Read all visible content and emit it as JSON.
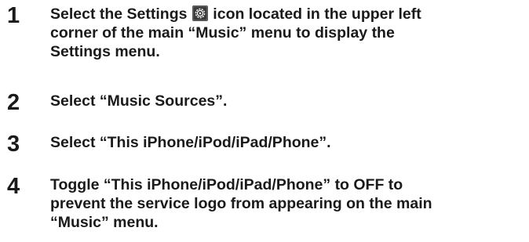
{
  "steps": [
    {
      "number": "1",
      "line1_before_icon": "Select the Settings ",
      "line1_icon": "settings-gear-icon",
      "line1_after_icon": " icon located in the upper left",
      "line2": "corner of the main “Music” menu to display the",
      "line3": "Settings menu."
    },
    {
      "number": "2",
      "line1": "Select “Music Sources”."
    },
    {
      "number": "3",
      "line1": "Select “This iPhone/iPod/iPad/Phone”."
    },
    {
      "number": "4",
      "line1": "Toggle “This iPhone/iPod/iPad/Phone” to OFF to",
      "line2": "prevent the service logo from appearing on the main",
      "line3": "“Music” menu."
    }
  ],
  "colors": {
    "text": "#1a1a1a",
    "icon_background": "#3a3a3a",
    "icon_foreground": "#ffffff"
  }
}
